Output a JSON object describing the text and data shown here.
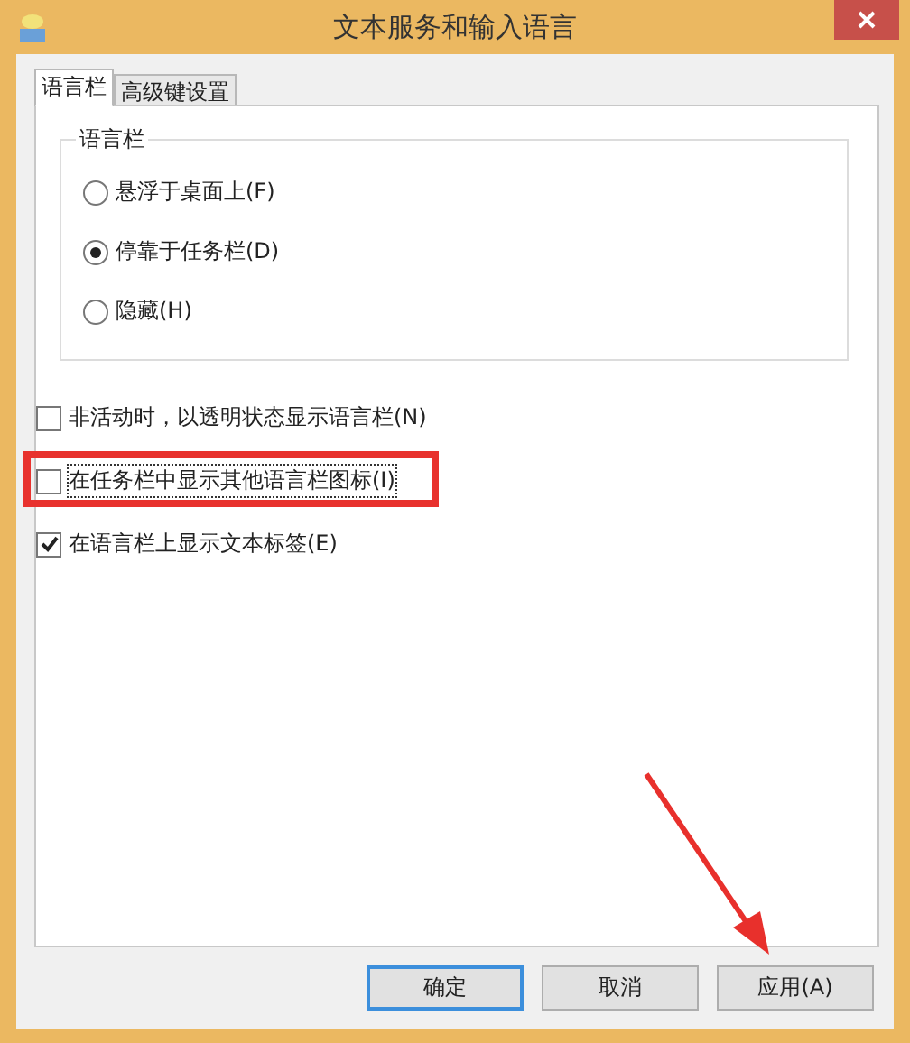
{
  "window": {
    "title": "文本服务和输入语言"
  },
  "tabs": [
    {
      "label": "语言栏",
      "selected": true
    },
    {
      "label": "高级键设置",
      "selected": false
    }
  ],
  "language_bar_group": {
    "title": "语言栏",
    "options": [
      {
        "label": "悬浮于桌面上(F)",
        "selected": false
      },
      {
        "label": "停靠于任务栏(D)",
        "selected": true
      },
      {
        "label": "隐藏(H)",
        "selected": false
      }
    ]
  },
  "checkboxes": [
    {
      "label": "非活动时，以透明状态显示语言栏(N)",
      "checked": false,
      "highlighted": false
    },
    {
      "label": "在任务栏中显示其他语言栏图标(I)",
      "checked": false,
      "highlighted": true
    },
    {
      "label": "在语言栏上显示文本标签(E)",
      "checked": true,
      "highlighted": false
    }
  ],
  "buttons": [
    {
      "label": "确定",
      "default": true
    },
    {
      "label": "取消",
      "default": false
    },
    {
      "label": "应用(A)",
      "default": false
    }
  ]
}
